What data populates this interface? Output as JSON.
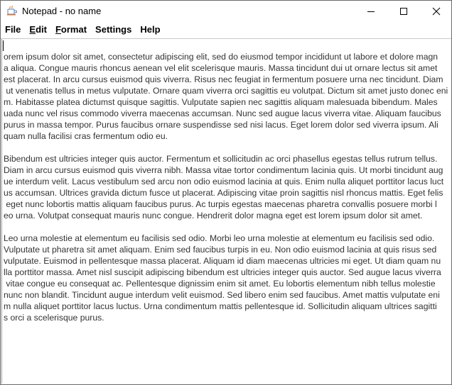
{
  "window": {
    "title": "Notepad - no name"
  },
  "icons": {
    "app": "java-coffee-cup-icon",
    "minimize": "minimize-icon",
    "maximize": "maximize-icon",
    "close": "close-icon"
  },
  "menubar": {
    "items": [
      {
        "mnemonic": "",
        "rest": "File"
      },
      {
        "mnemonic": "E",
        "rest": "dit"
      },
      {
        "mnemonic": "F",
        "rest": "ormat"
      },
      {
        "mnemonic": "",
        "rest": "Settings"
      },
      {
        "mnemonic": "",
        "rest": "Help"
      }
    ]
  },
  "editor": {
    "lines": [
      "orem ipsum dolor sit amet, consectetur adipiscing elit, sed do eiusmod tempor incididunt ut labore et dolore magn",
      "a aliqua. Congue mauris rhoncus aenean vel elit scelerisque mauris. Massa tincidunt dui ut ornare lectus sit amet",
      "est placerat. In arcu cursus euismod quis viverra. Risus nec feugiat in fermentum posuere urna nec tincidunt. Diam",
      " ut venenatis tellus in metus vulputate. Ornare quam viverra orci sagittis eu volutpat. Dictum sit amet justo donec eni",
      "m. Habitasse platea dictumst quisque sagittis. Vulputate sapien nec sagittis aliquam malesuada bibendum. Males",
      "uada nunc vel risus commodo viverra maecenas accumsan. Nunc sed augue lacus viverra vitae. Aliquam faucibus",
      "purus in massa tempor. Purus faucibus ornare suspendisse sed nisi lacus. Eget lorem dolor sed viverra ipsum. Ali",
      "quam nulla facilisi cras fermentum odio eu.",
      "",
      "Bibendum est ultricies integer quis auctor. Fermentum et sollicitudin ac orci phasellus egestas tellus rutrum tellus.",
      "Diam in arcu cursus euismod quis viverra nibh. Massa vitae tortor condimentum lacinia quis. Ut morbi tincidunt aug",
      "ue interdum velit. Lacus vestibulum sed arcu non odio euismod lacinia at quis. Enim nulla aliquet porttitor lacus luct",
      "us accumsan. Ultrices gravida dictum fusce ut placerat. Adipiscing vitae proin sagittis nisl rhoncus mattis. Eget felis",
      " eget nunc lobortis mattis aliquam faucibus purus. Ac turpis egestas maecenas pharetra convallis posuere morbi l",
      "eo urna. Volutpat consequat mauris nunc congue. Hendrerit dolor magna eget est lorem ipsum dolor sit amet.",
      "",
      "Leo urna molestie at elementum eu facilisis sed odio. Morbi leo urna molestie at elementum eu facilisis sed odio.",
      "Vulputate ut pharetra sit amet aliquam. Enim sed faucibus turpis in eu. Non odio euismod lacinia at quis risus sed",
      "vulputate. Euismod in pellentesque massa placerat. Aliquam id diam maecenas ultricies mi eget. Ut diam quam nu",
      "lla porttitor massa. Amet nisl suscipit adipiscing bibendum est ultricies integer quis auctor. Sed augue lacus viverra",
      " vitae congue eu consequat ac. Pellentesque dignissim enim sit amet. Eu lobortis elementum nibh tellus molestie",
      "nunc non blandit. Tincidunt augue interdum velit euismod. Sed libero enim sed faucibus. Amet mattis vulputate eni",
      "m nulla aliquet porttitor lacus luctus. Urna condimentum mattis pellentesque id. Sollicitudin aliquam ultrices sagitti",
      "s orci a scelerisque purus."
    ]
  }
}
